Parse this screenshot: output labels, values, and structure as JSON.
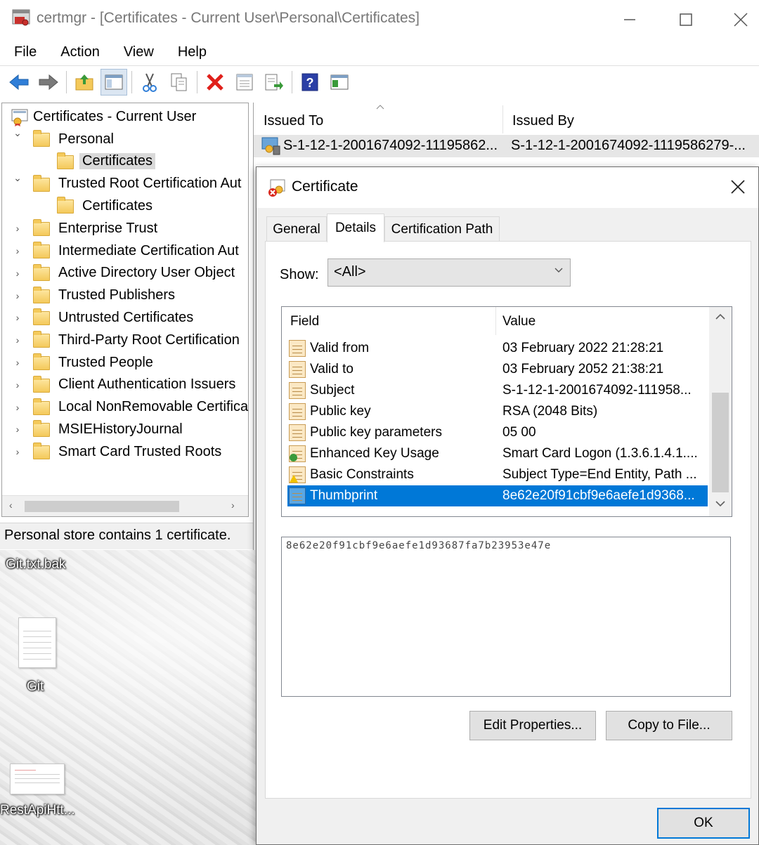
{
  "window": {
    "title": "certmgr - [Certificates - Current User\\Personal\\Certificates]"
  },
  "menu": [
    "File",
    "Action",
    "View",
    "Help"
  ],
  "toolbar": {
    "icons": [
      "back-arrow-icon",
      "forward-arrow-icon",
      "up-folder-icon",
      "show-hide-tree-icon",
      "cut-icon",
      "copy-icon",
      "delete-icon",
      "properties-icon",
      "export-icon",
      "help-icon",
      "console-icon"
    ]
  },
  "tree": {
    "root": "Certificates - Current User",
    "items": [
      {
        "label": "Personal"
      },
      {
        "label": "Certificates"
      },
      {
        "label": "Trusted Root Certification Aut"
      },
      {
        "label": "Certificates"
      },
      {
        "label": "Enterprise Trust"
      },
      {
        "label": "Intermediate Certification Aut"
      },
      {
        "label": "Active Directory User Object"
      },
      {
        "label": "Trusted Publishers"
      },
      {
        "label": "Untrusted Certificates"
      },
      {
        "label": "Third-Party Root Certification"
      },
      {
        "label": "Trusted People"
      },
      {
        "label": "Client Authentication Issuers"
      },
      {
        "label": "Local NonRemovable Certifica"
      },
      {
        "label": "MSIEHistoryJournal"
      },
      {
        "label": "Smart Card Trusted Roots"
      }
    ]
  },
  "status": "Personal store contains 1 certificate.",
  "list": {
    "columns": [
      "Issued To",
      "Issued By"
    ],
    "rows": [
      {
        "issued_to": "S-1-12-1-2001674092-11195862...",
        "issued_by": "S-1-12-1-2001674092-1119586279-..."
      }
    ]
  },
  "desktop": {
    "icons": [
      {
        "label": "Git.txt.bak"
      },
      {
        "label": "Git"
      },
      {
        "label": "RestApiHtt..."
      }
    ]
  },
  "dialog": {
    "title": "Certificate",
    "tabs": [
      "General",
      "Details",
      "Certification Path"
    ],
    "show_label": "Show:",
    "show_value": "<All>",
    "columns": [
      "Field",
      "Value"
    ],
    "fields": [
      {
        "field": "Valid from",
        "value": "03 February 2022 21:28:21"
      },
      {
        "field": "Valid to",
        "value": "03 February 2052 21:38:21"
      },
      {
        "field": "Subject",
        "value": "S-1-12-1-2001674092-111958..."
      },
      {
        "field": "Public key",
        "value": "RSA (2048 Bits)"
      },
      {
        "field": "Public key parameters",
        "value": "05 00"
      },
      {
        "field": "Enhanced Key Usage",
        "value": "Smart Card Logon (1.3.6.1.4.1...."
      },
      {
        "field": "Basic Constraints",
        "value": "Subject Type=End Entity, Path ..."
      },
      {
        "field": "Thumbprint",
        "value": "8e62e20f91cbf9e6aefe1d9368..."
      }
    ],
    "detail_value": "8e62e20f91cbf9e6aefe1d93687fa7b23953e47e",
    "buttons": {
      "edit_properties": "Edit Properties...",
      "copy_to_file": "Copy to File...",
      "ok": "OK"
    }
  }
}
